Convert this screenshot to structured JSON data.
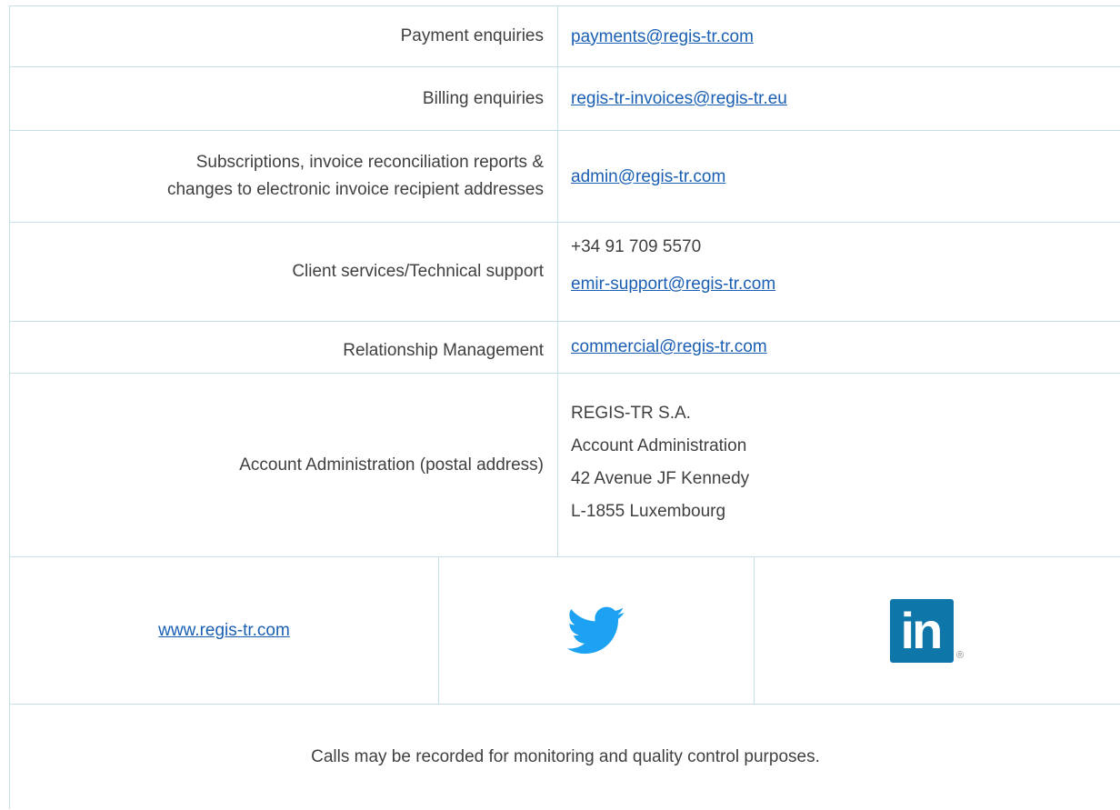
{
  "rows": [
    {
      "label": "Payment enquiries",
      "value": "payments@regis-tr.com"
    },
    {
      "label": "Billing enquiries",
      "value": "regis-tr-invoices@regis-tr.eu"
    },
    {
      "label_lines": [
        "Subscriptions, invoice reconciliation reports &",
        "changes to electronic invoice recipient addresses"
      ],
      "value": "admin@regis-tr.com"
    },
    {
      "label": "Client services/Technical support",
      "phone": "+34 91 709 5570",
      "value": "emir-support@regis-tr.com"
    },
    {
      "label": "Relationship Management",
      "value": "commercial@regis-tr.com"
    },
    {
      "label": "Account Administration (postal address)",
      "address_lines": [
        "REGIS-TR S.A.",
        "Account Administration",
        "42 Avenue JF Kennedy",
        "L-1855 Luxembourg"
      ]
    }
  ],
  "social": {
    "website": "www.regis-tr.com",
    "twitter_icon": "twitter-bird-icon",
    "linkedin_icon": "linkedin-icon",
    "linkedin_text": "in",
    "linkedin_reg": "®"
  },
  "footer_note": "Calls may be recorded for monitoring and quality control purposes.",
  "colors": {
    "border": "#c5dfe9",
    "link": "#1a5fb4",
    "text": "#404040",
    "twitter": "#1da1f2",
    "linkedin": "#0e76a8"
  }
}
